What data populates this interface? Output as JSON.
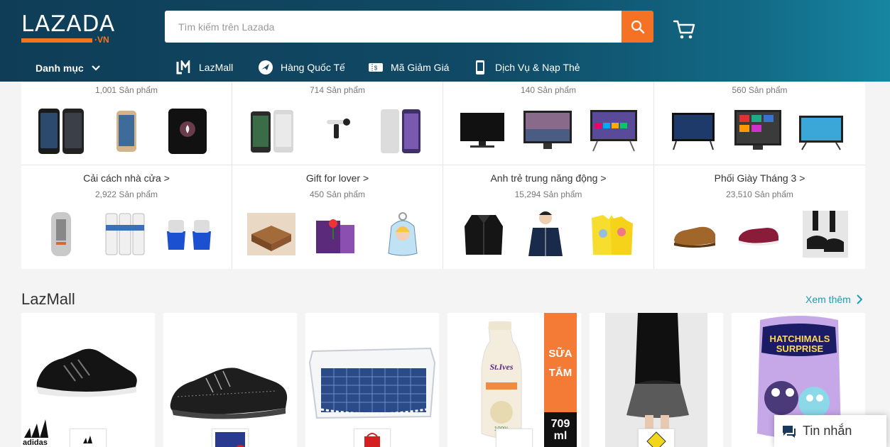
{
  "header": {
    "logo_text": "LAZADA",
    "logo_suffix": "·VN",
    "search_placeholder": "Tìm kiếm trên Lazada",
    "brand_color": "#f57224",
    "header_color": "#0f3d57"
  },
  "nav": {
    "category_label": "Danh mục",
    "items": [
      {
        "label": "LazMall",
        "icon": "lazmall-icon"
      },
      {
        "label": "Hàng Quốc Tế",
        "icon": "plane-icon"
      },
      {
        "label": "Mã Giảm Giá",
        "icon": "voucher-icon"
      },
      {
        "label": "Dịch Vụ & Nạp Thẻ",
        "icon": "phone-icon"
      }
    ]
  },
  "categories": {
    "row1": [
      {
        "title": "",
        "count": "1,001 Sản phẩm",
        "images": [
          "samsung-phone",
          "samsung-phone-gold",
          "iphone-black"
        ]
      },
      {
        "title": "",
        "count": "714 Sản phẩm",
        "images": [
          "nokia-phone",
          "selfie-stick",
          "nokia-phone-white"
        ]
      },
      {
        "title": "",
        "count": "140 Sản phẩm",
        "images": [
          "tv-sony",
          "tv-landscape",
          "tv-smart"
        ]
      },
      {
        "title": "",
        "count": "560 Sản phẩm",
        "images": [
          "tv-samsung",
          "tv-apps",
          "tv-screen"
        ]
      }
    ],
    "row2": [
      {
        "title": "Cải cách nhà cửa >",
        "count": "2,922 Sản phẩm",
        "images": [
          "remote-device",
          "water-filter",
          "filter-cups"
        ]
      },
      {
        "title": "Gift for lover >",
        "count": "450 Sản phẩm",
        "images": [
          "wood-tiles",
          "gift-rose-box",
          "keychain"
        ]
      },
      {
        "title": "Anh trẻ trung năng động >",
        "count": "15,294 Sản phẩm",
        "images": [
          "black-jacket",
          "navy-jacket",
          "yellow-tshirts"
        ]
      },
      {
        "title": "Phối Giày Tháng 3 >",
        "count": "23,510 Sản phẩm",
        "images": [
          "brown-shoe",
          "red-sneaker",
          "black-boot"
        ]
      }
    ]
  },
  "lazmall": {
    "title": "LazMall",
    "more_label": "Xem thêm",
    "products": [
      {
        "name": "adidas black running shoe",
        "brand": "adidas"
      },
      {
        "name": "black knit sneaker",
        "brand": "brand-blue"
      },
      {
        "name": "storage box with blanket",
        "brand": "brand-red"
      },
      {
        "name": "St.Ives body wash",
        "brand": "stives",
        "badge_top": "SỮA TẮM",
        "badge_bottom": "709 ml",
        "bottle_text": "St.Ives",
        "percent": "100%"
      },
      {
        "name": "black mesh skirt",
        "brand": "brand-yellow"
      },
      {
        "name": "Hatchimals Surprise",
        "brand": "hatchimals",
        "box_text": "HATCHIMALS SURPRISE"
      }
    ]
  },
  "chat": {
    "label": "Tin nhắn"
  }
}
